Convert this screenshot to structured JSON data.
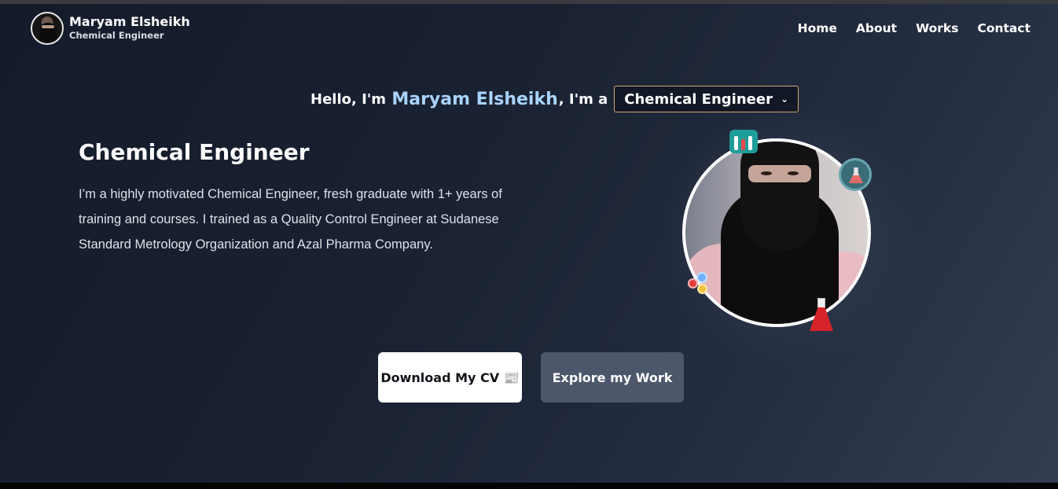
{
  "header": {
    "name": "Maryam Elsheikh",
    "subtitle": "Chemical Engineer",
    "nav": [
      "Home",
      "About",
      "Works",
      "Contact"
    ]
  },
  "hero": {
    "greeting_prefix": "Hello, I'm ",
    "greeting_name": "Maryam Elsheikh",
    "greeting_suffix": ", I'm a",
    "role_selected": "Chemical Engineer",
    "title": "Chemical Engineer",
    "description": "I’m a highly motivated Chemical Engineer, fresh graduate with 1+ years of training and courses. I trained as a Quality Control Engineer at Sudanese Standard Metrology Organization and Azal Pharma Company."
  },
  "buttons": {
    "download_cv": "Download My CV 📰",
    "explore_work": "Explore my Work"
  },
  "colors": {
    "accent_name": "#a9d3ff",
    "select_border": "#d7a86e",
    "secondary_button": "#4c576b"
  },
  "icons": [
    "avatar-photo",
    "chevron-down-icon",
    "test-tubes-icon",
    "flask-icon",
    "molecule-icon",
    "erlenmeyer-flask-icon"
  ]
}
